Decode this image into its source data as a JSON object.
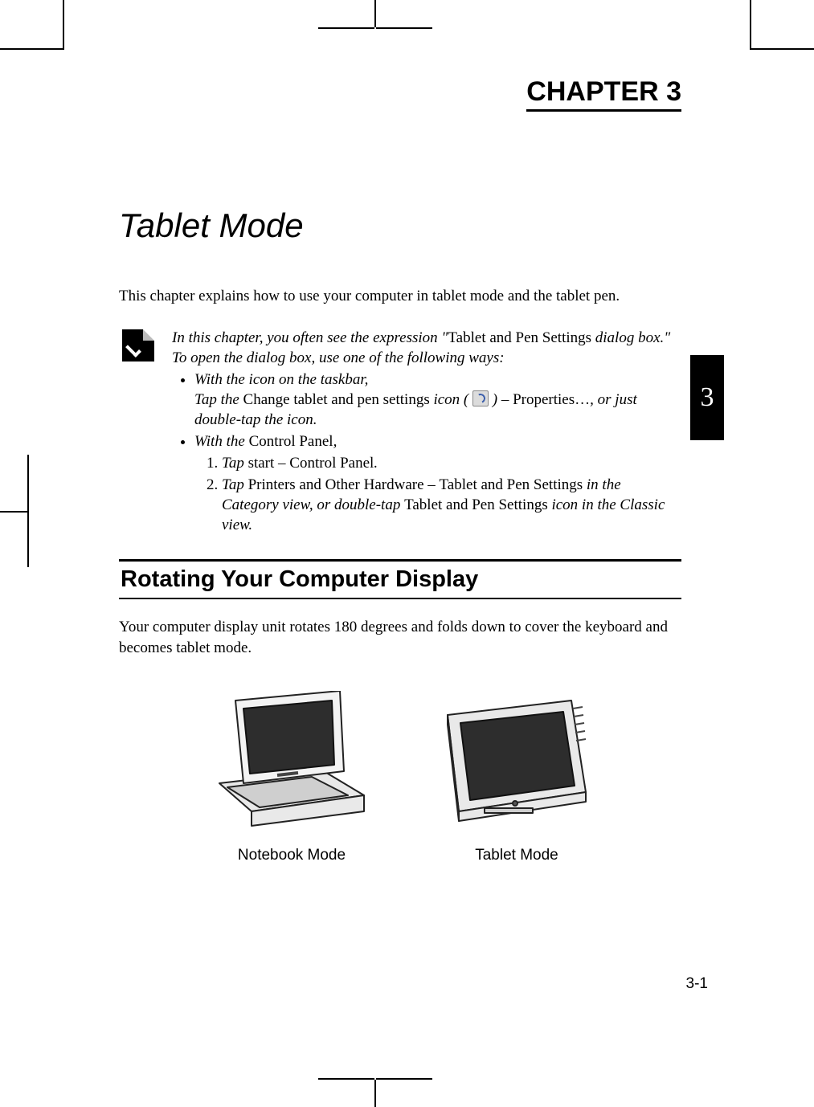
{
  "header": {
    "chapter_label": "CHAPTER 3"
  },
  "title": "Tablet Mode",
  "intro": "This chapter explains how to use your computer in tablet mode and the tablet pen.",
  "note": {
    "lead_in_1": "In this chapter, you often see the expression \"",
    "lead_in_term": "Tablet and Pen Settings",
    "lead_in_2": " dialog box.\"  To open the dialog box, use one of the following ways:",
    "bullet1_line1": "With the icon on the taskbar,",
    "bullet1_tap_the": "Tap the ",
    "bullet1_change_label": "Change tablet and pen settings",
    "bullet1_icon_word": " icon ( ",
    "bullet1_dash": " ) – ",
    "bullet1_properties": "Properties…",
    "bullet1_tail": ", or just double-tap the icon.",
    "bullet2_line1_pre": "With the ",
    "bullet2_line1_cp": "Control Panel",
    "bullet2_line1_post": ",",
    "step1_pre": "Tap ",
    "step1_start": "start",
    "step1_mid": " – ",
    "step1_cp": "Control Panel",
    "step1_post": ".",
    "step2_pre": "Tap ",
    "step2_poh": "Printers and Other Hardware",
    "step2_mid1": " – ",
    "step2_tps1": "Tablet and Pen Settings",
    "step2_mid2": " in the Category view, or double-tap ",
    "step2_tps2": "Tablet and Pen Settings",
    "step2_tail": " icon in the Classic view."
  },
  "section_heading": "Rotating Your Computer Display",
  "body": "Your computer display unit rotates 180 degrees and folds down to cover the keyboard and becomes tablet mode.",
  "figures": {
    "notebook_caption": "Notebook Mode",
    "tablet_caption": "Tablet Mode"
  },
  "side_tab": "3",
  "page_number": "3-1"
}
